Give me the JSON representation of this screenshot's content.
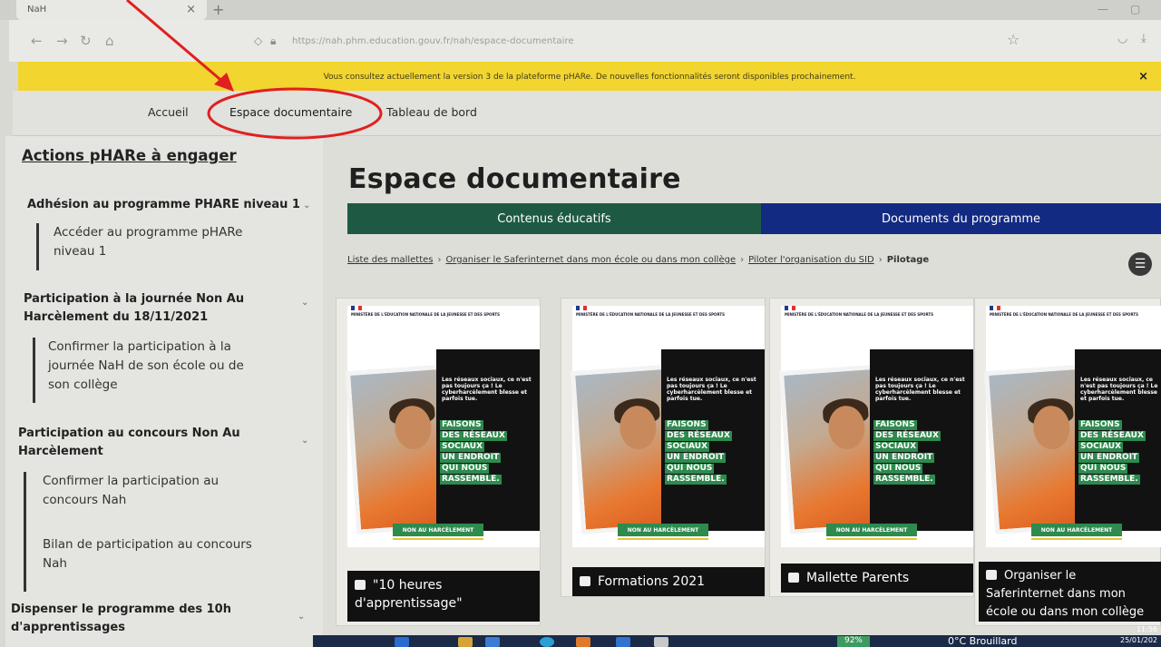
{
  "browser": {
    "tab_title": "NaH",
    "new_tab": "+",
    "tab_close": "×",
    "url": "https://nah.phm.education.gouv.fr/nah/espace-documentaire"
  },
  "banner": {
    "message": "Vous consultez actuellement la version 3 de la plateforme pHARe. De nouvelles fonctionnalités seront disponibles prochainement.",
    "close": "×"
  },
  "site_nav": {
    "items": [
      "Accueil",
      "Espace documentaire",
      "Tableau de bord"
    ]
  },
  "sidebar": {
    "title": "Actions pHARe à engager",
    "sections": [
      {
        "title": "Adhésion au programme PHARE niveau 1",
        "items": [
          "Accéder au programme pHARe niveau 1"
        ]
      },
      {
        "title": "Participation à la journée Non Au Harcèlement du 18/11/2021",
        "items": [
          "Confirmer la participation à la journée NaH de son école ou de son collège"
        ]
      },
      {
        "title": "Participation au concours Non Au Harcèlement",
        "items": [
          "Confirmer la participation au concours Nah",
          "Bilan de participation au concours Nah"
        ]
      },
      {
        "title": "Dispenser le programme des 10h d'apprentissages",
        "items": []
      }
    ]
  },
  "main": {
    "title": "Espace documentaire",
    "tabs": [
      "Contenus éducatifs",
      "Documents du programme"
    ],
    "breadcrumb": [
      "Liste des mallettes",
      "Organiser le Saferinternet dans mon école ou dans mon collège",
      "Piloter l'organisation du SID",
      "Pilotage"
    ],
    "menu_icon": "☰",
    "cards": [
      {
        "caption": "\"10 heures d'apprentissage\""
      },
      {
        "caption": "Formations 2021"
      },
      {
        "caption": "Mallette Parents"
      },
      {
        "caption": "Organiser le Saferinternet dans mon école ou dans mon collège"
      }
    ],
    "poster": {
      "ministry": "MINISTÈRE DE L'ÉDUCATION NATIONALE DE LA JEUNESSE ET DES SPORTS",
      "quote": "Les réseaux sociaux, ce n'est pas toujours ça ! Le cyberharcèlement blesse et parfois tue.",
      "slogan": [
        "FAISONS",
        "DES RÉSEAUX",
        "SOCIAUX",
        "UN ENDROIT",
        "QUI NOUS",
        "RASSEMBLE."
      ],
      "badge": "NON AU HARCÈLEMENT"
    }
  },
  "taskbar": {
    "battery": "92%",
    "weather": "0°C Brouillard",
    "time": "11:56",
    "date": "25/01/202"
  },
  "colors": {
    "banner": "#f2d52f",
    "tab_green": "#1e5a43",
    "tab_blue": "#122a82",
    "annotation": "#e02020"
  }
}
